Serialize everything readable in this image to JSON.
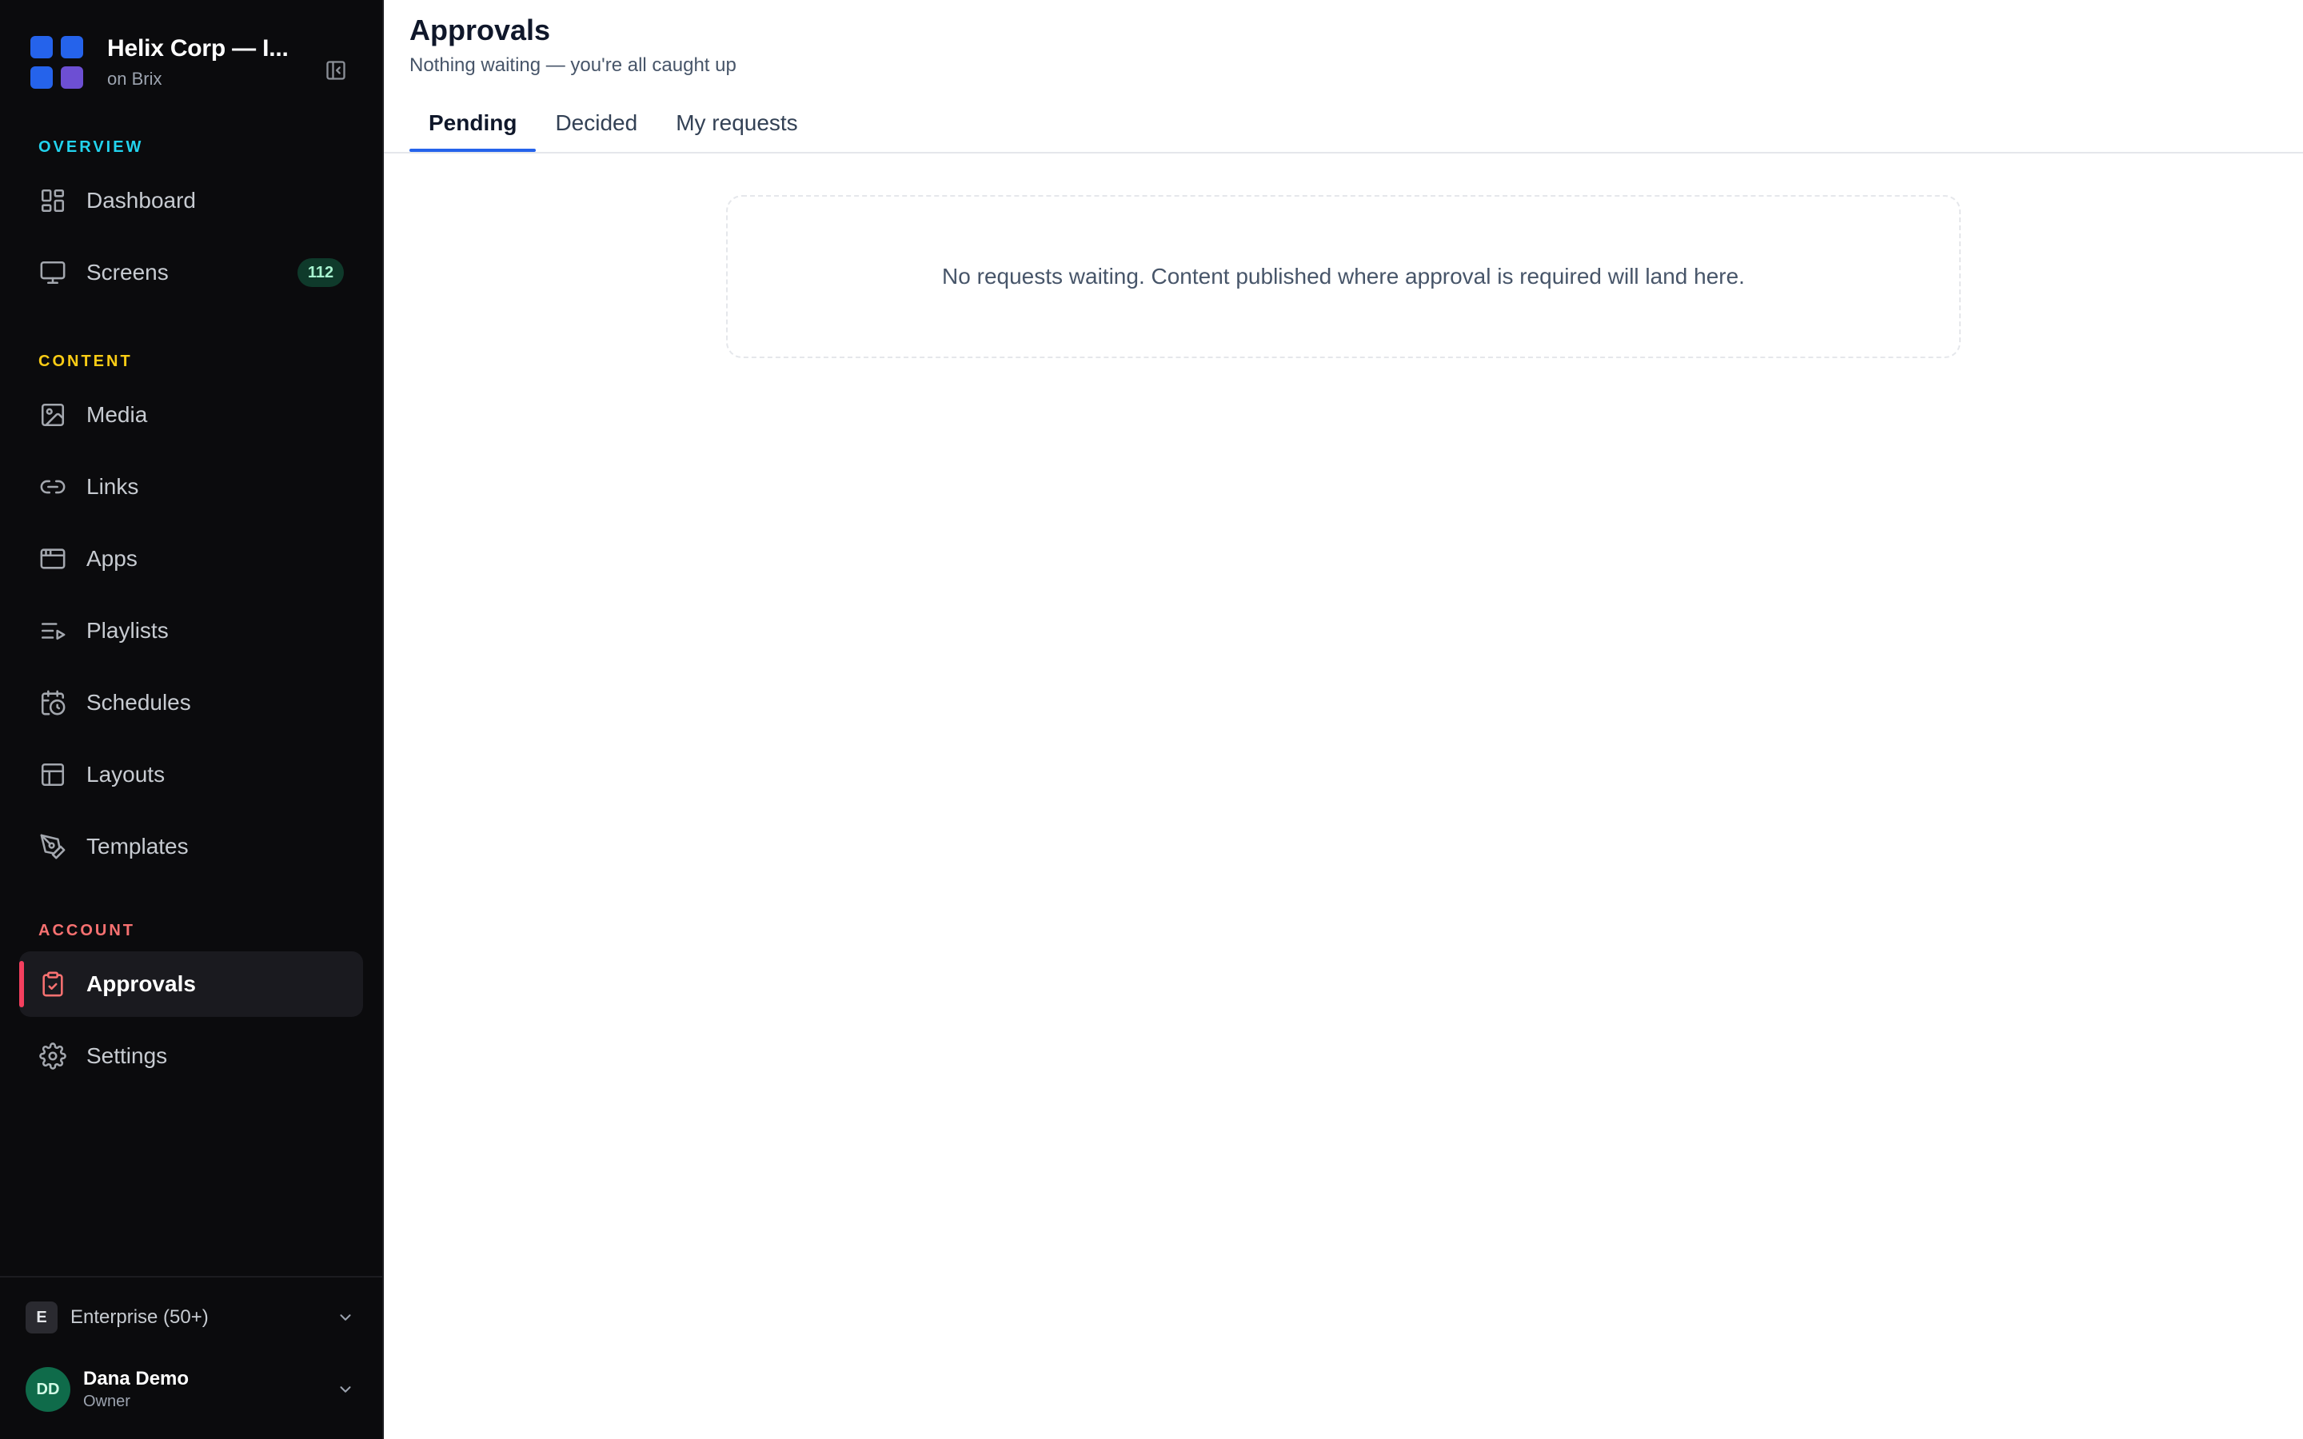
{
  "sidebar": {
    "brand": {
      "title": "Helix Corp — I...",
      "subtitle": "on Brix",
      "logo_colors": [
        "#2563eb",
        "#2563eb",
        "#2563eb",
        "#6d4fd3"
      ]
    },
    "sections": [
      {
        "label": "OVERVIEW",
        "color": "#22d3ee",
        "items": [
          {
            "label": "Dashboard",
            "icon": "dashboard-icon"
          },
          {
            "label": "Screens",
            "icon": "monitor-icon",
            "badge": "112"
          }
        ]
      },
      {
        "label": "CONTENT",
        "color": "#facc15",
        "items": [
          {
            "label": "Media",
            "icon": "image-icon"
          },
          {
            "label": "Links",
            "icon": "link-icon"
          },
          {
            "label": "Apps",
            "icon": "app-window-icon"
          },
          {
            "label": "Playlists",
            "icon": "playlist-icon"
          },
          {
            "label": "Schedules",
            "icon": "calendar-clock-icon"
          },
          {
            "label": "Layouts",
            "icon": "layout-icon"
          },
          {
            "label": "Templates",
            "icon": "pen-tool-icon"
          }
        ]
      },
      {
        "label": "ACCOUNT",
        "color": "#f87171",
        "items": [
          {
            "label": "Approvals",
            "icon": "clipboard-check-icon",
            "active": true
          },
          {
            "label": "Settings",
            "icon": "gear-icon"
          }
        ]
      }
    ],
    "footer": {
      "plan_initial": "E",
      "plan_label": "Enterprise (50+)",
      "user_initials": "DD",
      "user_name": "Dana Demo",
      "user_role": "Owner"
    }
  },
  "main": {
    "title": "Approvals",
    "subtitle": "Nothing waiting — you're all caught up",
    "tabs": [
      {
        "label": "Pending",
        "active": true
      },
      {
        "label": "Decided"
      },
      {
        "label": "My requests"
      }
    ],
    "empty_message": "No requests waiting. Content published where approval is required will land here.",
    "accent_color": "#2563eb"
  }
}
